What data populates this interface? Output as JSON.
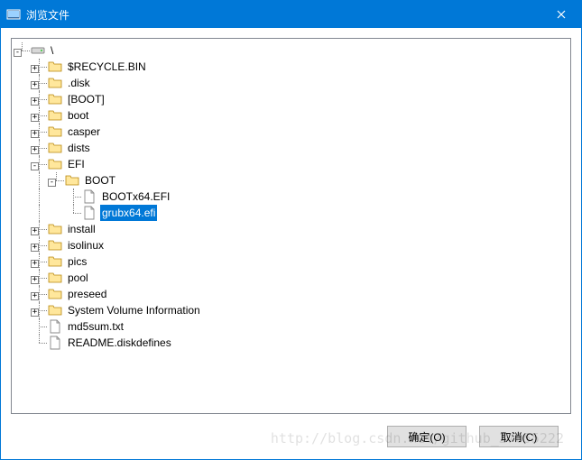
{
  "title": "浏览文件",
  "buttons": {
    "ok": "确定(O)",
    "cancel": "取消(C)"
  },
  "watermark": "http://blog.csdn.net/github_37055222",
  "icons": {
    "drive": "drive-icon",
    "folder": "folder-icon",
    "file": "file-icon"
  },
  "tree": {
    "root": {
      "label": "\\",
      "icon": "drive",
      "expanded": true,
      "children": [
        {
          "label": "$RECYCLE.BIN",
          "icon": "folder",
          "hasChildren": true
        },
        {
          "label": ".disk",
          "icon": "folder",
          "hasChildren": true
        },
        {
          "label": "[BOOT]",
          "icon": "folder",
          "hasChildren": true
        },
        {
          "label": "boot",
          "icon": "folder",
          "hasChildren": true
        },
        {
          "label": "casper",
          "icon": "folder",
          "hasChildren": true
        },
        {
          "label": "dists",
          "icon": "folder",
          "hasChildren": true
        },
        {
          "label": "EFI",
          "icon": "folder",
          "hasChildren": true,
          "expanded": true,
          "children": [
            {
              "label": "BOOT",
              "icon": "folder",
              "hasChildren": true,
              "expanded": true,
              "children": [
                {
                  "label": "BOOTx64.EFI",
                  "icon": "file"
                },
                {
                  "label": "grubx64.efi",
                  "icon": "file",
                  "selected": true
                }
              ]
            }
          ]
        },
        {
          "label": "install",
          "icon": "folder",
          "hasChildren": true
        },
        {
          "label": "isolinux",
          "icon": "folder",
          "hasChildren": true
        },
        {
          "label": "pics",
          "icon": "folder",
          "hasChildren": true
        },
        {
          "label": "pool",
          "icon": "folder",
          "hasChildren": true
        },
        {
          "label": "preseed",
          "icon": "folder",
          "hasChildren": true
        },
        {
          "label": "System Volume Information",
          "icon": "folder",
          "hasChildren": true
        },
        {
          "label": "md5sum.txt",
          "icon": "file"
        },
        {
          "label": "README.diskdefines",
          "icon": "file"
        }
      ]
    }
  }
}
